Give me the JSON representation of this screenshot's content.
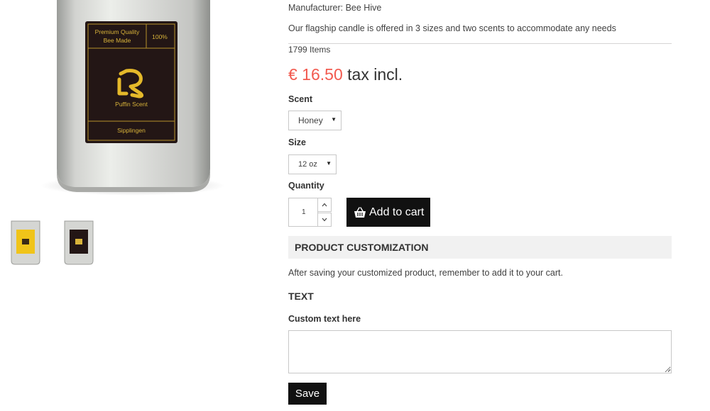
{
  "product_image": {
    "label_quality_line1": "Premium Quality",
    "label_quality_line2": "Bee Made",
    "label_percent": "100%",
    "label_name": "Puffin Scent",
    "label_place": "Sipplingen"
  },
  "product": {
    "manufacturer_text": "Manufacturer: Bee Hive",
    "description": "Our flagship candle is offered in 3 sizes and two scents to accommodate any needs",
    "stock": "1799 Items",
    "price": "€ 16.50",
    "tax_label": "tax incl."
  },
  "options": {
    "scent_label": "Scent",
    "scent_value": "Honey",
    "size_label": "Size",
    "size_value": "12 oz",
    "quantity_label": "Quantity",
    "quantity_value": "1"
  },
  "actions": {
    "add_to_cart": "Add to cart",
    "save": "Save"
  },
  "customization": {
    "header": "PRODUCT CUSTOMIZATION",
    "note": "After saving your customized product, remember to add it to your cart.",
    "text_heading": "TEXT",
    "field_label": "Custom text here",
    "field_value": ""
  },
  "colors": {
    "price": "#f25a4f",
    "button_bg": "#111111",
    "label_bg": "#231615",
    "label_gold": "#d8b33a"
  }
}
